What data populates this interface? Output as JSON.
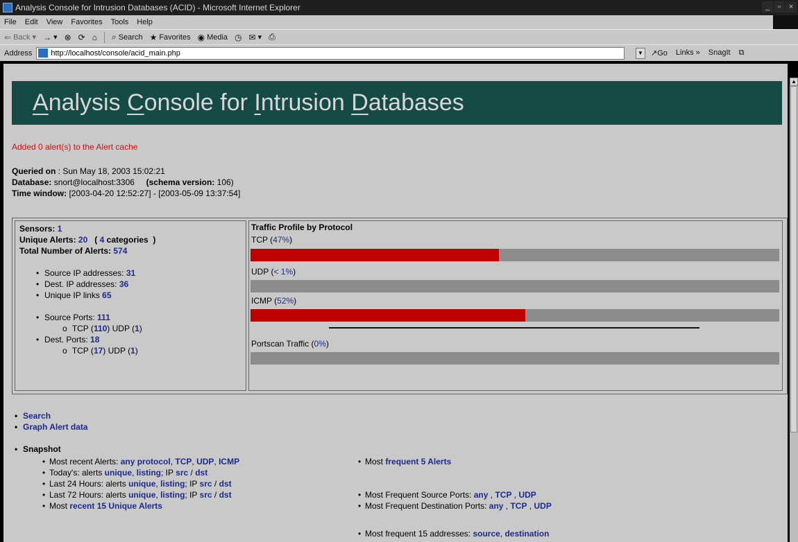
{
  "window": {
    "title": "Analysis Console for Intrusion Databases (ACID) - Microsoft Internet Explorer",
    "controls": [
      "_",
      "▫",
      "×"
    ]
  },
  "menu": [
    "File",
    "Edit",
    "View",
    "Favorites",
    "Tools",
    "Help"
  ],
  "toolbar": {
    "back": "Back",
    "search": "Search",
    "favorites": "Favorites",
    "media": "Media"
  },
  "address": {
    "label": "Address",
    "url": "http://localhost/console/acid_main.php",
    "go": "Go",
    "links": "Links »",
    "snagit": "SnagIt"
  },
  "page": {
    "banner": {
      "w1": "A",
      "w1rest": "nalysis ",
      "w2": "C",
      "w2rest": "onsole for ",
      "w3": "I",
      "w3rest": "ntrusion ",
      "w4": "D",
      "w4rest": "atabases"
    },
    "cache_message": "Added 0 alert(s) to the Alert cache",
    "query": {
      "queried_label": "Queried on",
      "queried_value": " : Sun May 18, 2003 15:02:21",
      "database_label": "Database:",
      "database_value": " snort@localhost:3306",
      "schema_label": "(schema version:",
      "schema_value": " 106)",
      "window_label": "Time window:",
      "window_value": " [2003-04-20 12:52:27] - [2003-05-09 13:37:54]"
    },
    "stats": {
      "sensors_label": "Sensors:",
      "sensors_value": "1",
      "unique_label": "Unique Alerts:",
      "unique_value": "20",
      "categories_open": "(",
      "categories_value": "4",
      "categories_label": "categories",
      "categories_close": ")",
      "total_label": "Total Number of Alerts:",
      "total_value": "574",
      "src_ip_label": "Source IP addresses:",
      "src_ip_value": "31",
      "dst_ip_label": "Dest. IP addresses:",
      "dst_ip_value": "36",
      "ip_links_label": "Unique IP links",
      "ip_links_value": "65",
      "src_ports_label": "Source Ports:",
      "src_ports_value": "111",
      "src_tcp_label": "TCP (",
      "src_tcp_value": "110",
      "src_udp_label": ") UDP (",
      "src_udp_value": "1",
      "src_close": ")",
      "dst_ports_label": "Dest. Ports:",
      "dst_ports_value": "18",
      "dst_tcp_label": "TCP (",
      "dst_tcp_value": "17",
      "dst_udp_label": ") UDP (",
      "dst_udp_value": "1",
      "dst_close": ")"
    },
    "traffic": {
      "title": "Traffic Profile by Protocol",
      "protocols": [
        {
          "name": "TCP",
          "pct_text": "47%",
          "fraction": 0.47
        },
        {
          "name": "UDP",
          "pct_text": "< 1%",
          "fraction": 0.0
        },
        {
          "name": "ICMP",
          "pct_text": "52%",
          "fraction": 0.52
        }
      ],
      "portscan": {
        "name": "Portscan Traffic",
        "pct_text": "0%",
        "fraction": 0.0
      }
    },
    "links": {
      "search": "Search",
      "graph": "Graph Alert data",
      "snapshot": "Snapshot",
      "recent_label": "Most recent Alerts:",
      "recent_any": "any protocol",
      "recent_tcp": "TCP",
      "recent_udp": "UDP",
      "recent_icmp": "ICMP",
      "today_label": "Today's: alerts",
      "today_unique": "unique",
      "today_listing": "listing",
      "today_ip": "; IP",
      "today_src": "src",
      "today_dst": "dst",
      "h24_label": "Last 24 Hours: alerts",
      "h24_unique": "unique",
      "h24_listing": "listing",
      "h24_ip": "; IP",
      "h24_src": "src",
      "h24_dst": "dst",
      "h72_label": "Last 72 Hours: alerts",
      "h72_unique": "unique",
      "h72_listing": "listing",
      "h72_ip": "; IP",
      "h72_src": "src",
      "h72_dst": "dst",
      "recent15_label": "Most",
      "recent15_link": "recent 15 Unique Alerts",
      "freq5_label": "Most",
      "freq5_link": "frequent 5 Alerts",
      "freq_src_label": "Most Frequent Source Ports:",
      "freq_src_any": "any",
      "freq_src_tcp": "TCP",
      "freq_src_udp": "UDP",
      "freq_dst_label": "Most Frequent Destination Ports:",
      "freq_dst_any": "any",
      "freq_dst_tcp": "TCP",
      "freq_dst_udp": "UDP",
      "freq15_label": "Most frequent 15 addresses:",
      "freq15_source": "source",
      "freq15_dest": "destination"
    }
  },
  "colors": {
    "banner_bg": "#154a45",
    "bar_fill": "#c00000",
    "bar_track": "#8c8c8c",
    "link": "#1c2a8c",
    "alert_text": "#cc1111"
  }
}
